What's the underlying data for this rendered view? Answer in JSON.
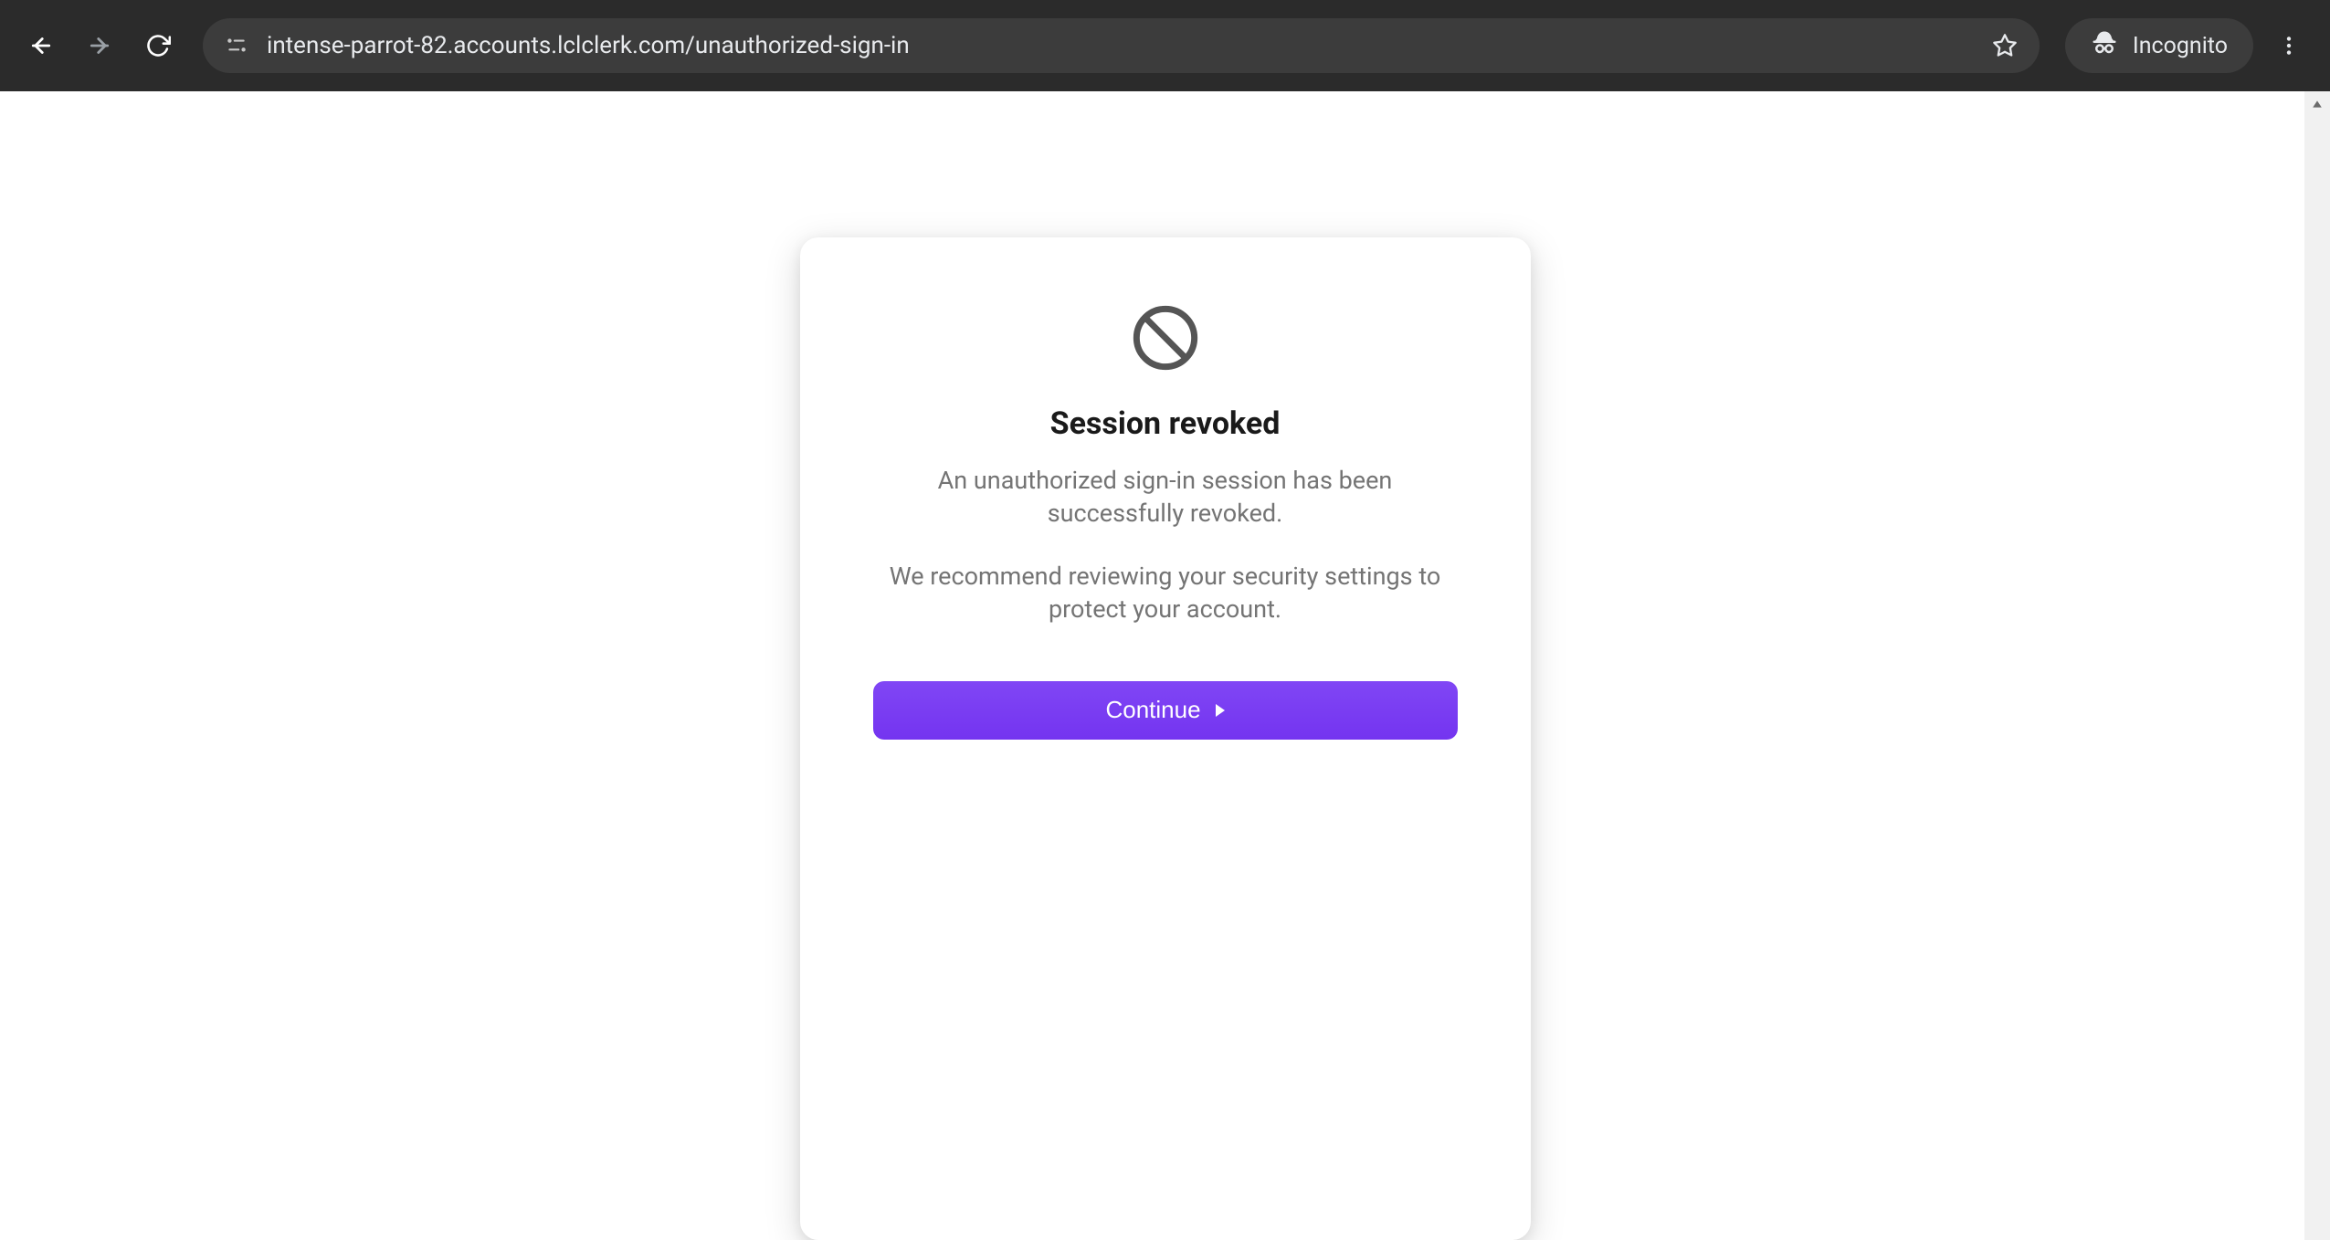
{
  "browser": {
    "url": "intense-parrot-82.accounts.lclclerk.com/unauthorized-sign-in",
    "incognito_label": "Incognito"
  },
  "card": {
    "title": "Session revoked",
    "paragraph1": "An unauthorized sign-in session has been successfully revoked.",
    "paragraph2": "We recommend reviewing your security settings to protect your account.",
    "button_label": "Continue"
  }
}
